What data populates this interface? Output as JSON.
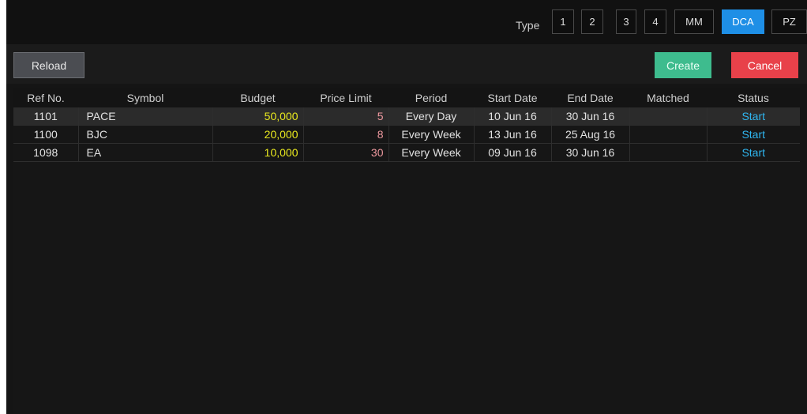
{
  "type_bar": {
    "label": "Type",
    "options": [
      "1",
      "2",
      "3",
      "4",
      "MM",
      "DCA",
      "PZ"
    ],
    "selected": "DCA"
  },
  "toolbar": {
    "reload_label": "Reload",
    "create_label": "Create",
    "cancel_label": "Cancel"
  },
  "table": {
    "columns": [
      "Ref No.",
      "Symbol",
      "Budget",
      "Price Limit",
      "Period",
      "Start Date",
      "End Date",
      "Matched",
      "Status"
    ],
    "rows": [
      {
        "ref": "1101",
        "symbol": "PACE",
        "budget": "50,000",
        "price_limit": "5",
        "period": "Every Day",
        "start_date": "10 Jun 16",
        "end_date": "30 Jun 16",
        "matched": "",
        "status": "Start"
      },
      {
        "ref": "1100",
        "symbol": "BJC",
        "budget": "20,000",
        "price_limit": "8",
        "period": "Every Week",
        "start_date": "13 Jun 16",
        "end_date": "25 Aug 16",
        "matched": "",
        "status": "Start"
      },
      {
        "ref": "1098",
        "symbol": "EA",
        "budget": "10,000",
        "price_limit": "30",
        "period": "Every Week",
        "start_date": "09 Jun 16",
        "end_date": "30 Jun 16",
        "matched": "",
        "status": "Start"
      }
    ]
  },
  "colors": {
    "selected_type": "#1e8fe6",
    "create": "#3ebc8e",
    "cancel": "#e8414a",
    "budget_text": "#e8e81e",
    "price_limit_text": "#f09aa0",
    "status_text": "#2fb6f0"
  }
}
